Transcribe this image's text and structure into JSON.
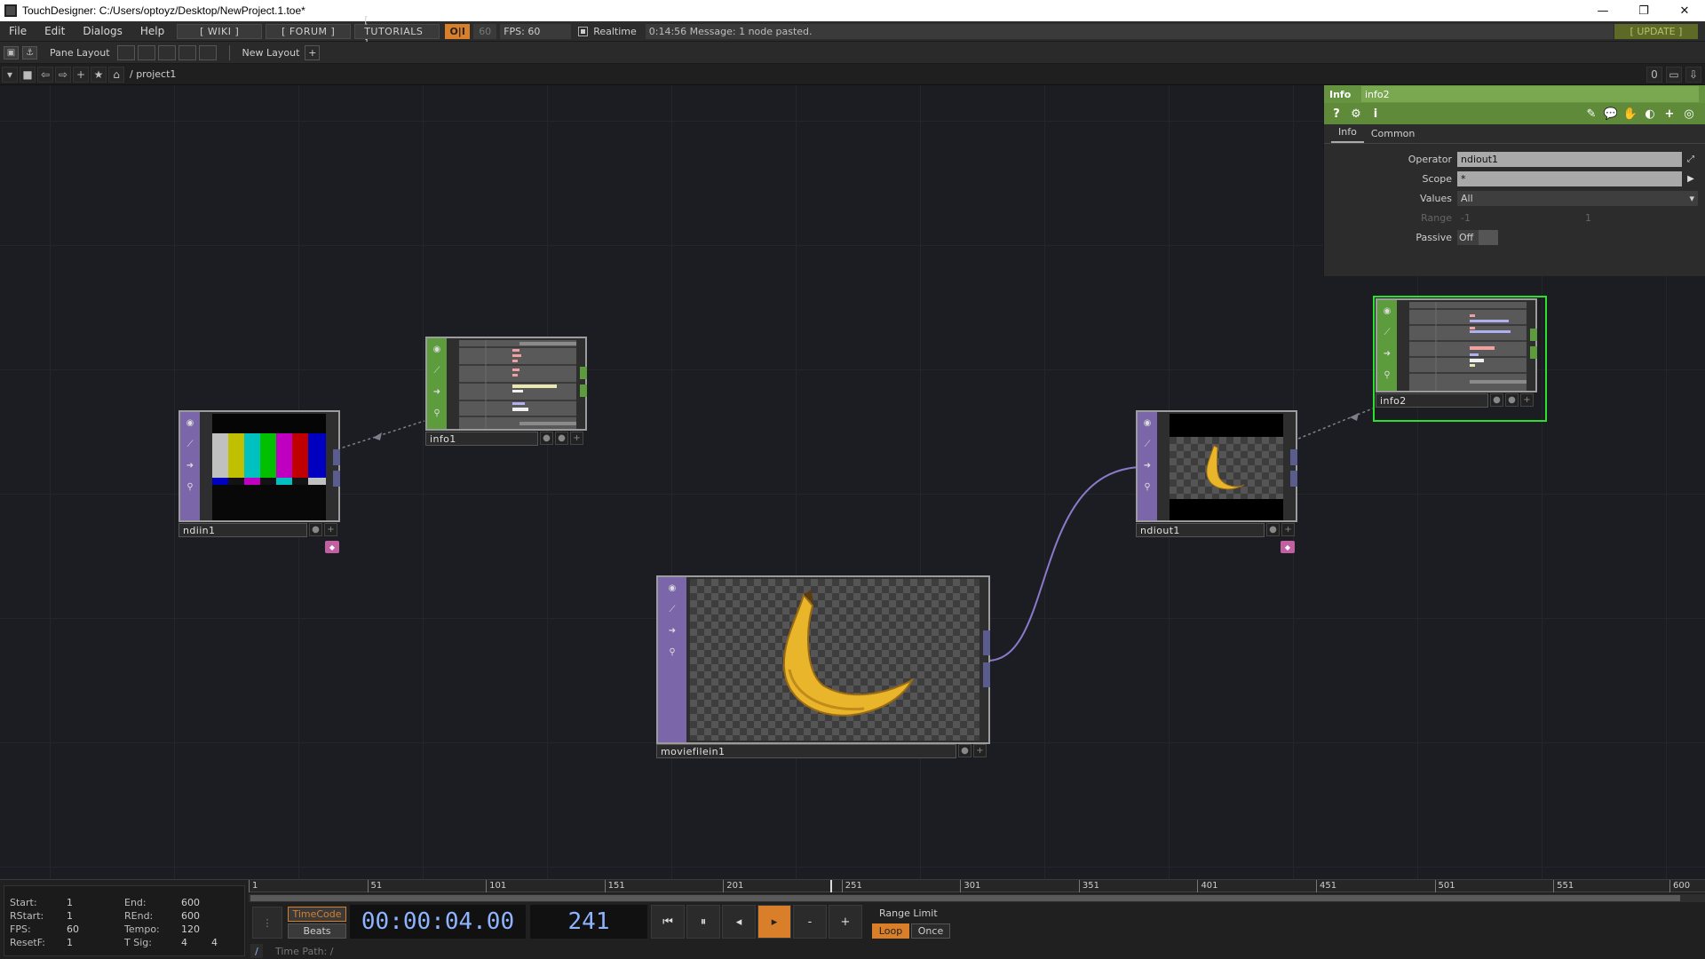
{
  "window": {
    "title": "TouchDesigner: C:/Users/optoyz/Desktop/NewProject.1.toe*",
    "min": "—",
    "restore": "❐",
    "close": "✕"
  },
  "menubar": {
    "items": [
      "File",
      "Edit",
      "Dialogs",
      "Help"
    ],
    "wiki": "[ WIKI ]",
    "forum": "[ FORUM ]",
    "tutorials": "[ TUTORIALS ]",
    "oi": "O|I",
    "fps_box": "60",
    "fps_label": "FPS:  60",
    "realtime": "Realtime",
    "message": "0:14:56 Message: 1 node pasted.",
    "update": "[ UPDATE ]"
  },
  "panebar": {
    "pane_layout": "Pane Layout",
    "new_layout": "New Layout",
    "plus": "+"
  },
  "pathbar": {
    "path": "/ project1",
    "zero": "0"
  },
  "nodes": {
    "ndiin1": {
      "name": "ndiin1"
    },
    "info1": {
      "name": "info1"
    },
    "moviefilein1": {
      "name": "moviefilein1"
    },
    "ndiout1": {
      "name": "ndiout1"
    },
    "info2": {
      "name": "info2"
    }
  },
  "info_panel": {
    "type": "Info",
    "name": "info2",
    "tabs": [
      "Info",
      "Common"
    ],
    "params": {
      "operator_label": "Operator",
      "operator_value": "ndiout1",
      "scope_label": "Scope",
      "scope_value": "*",
      "values_label": "Values",
      "values_value": "All",
      "range_label": "Range",
      "range_min": "-1",
      "range_max": "1",
      "passive_label": "Passive",
      "passive_value": "Off"
    }
  },
  "timeline": {
    "stats": {
      "start_k": "Start:",
      "start_v": "1",
      "rstart_k": "RStart:",
      "rstart_v": "1",
      "fps_k": "FPS:",
      "fps_v": "60",
      "resetf_k": "ResetF:",
      "resetf_v": "1",
      "end_k": "End:",
      "end_v": "600",
      "rend_k": "REnd:",
      "rend_v": "600",
      "tempo_k": "Tempo:",
      "tempo_v": "120",
      "tsig_k": "T Sig:",
      "tsig_v1": "4",
      "tsig_v2": "4"
    },
    "ticks": [
      "1",
      "51",
      "101",
      "151",
      "201",
      "251",
      "301",
      "351",
      "401",
      "451",
      "501",
      "551",
      "600"
    ],
    "timecode_btn": "TimeCode",
    "beats_btn": "Beats",
    "time": "00:00:04.00",
    "frame": "241",
    "range_limit": "Range Limit",
    "loop": "Loop",
    "once": "Once",
    "time_path_slash": "/",
    "time_path": "Time Path: /",
    "minus": "-",
    "plus": "+"
  }
}
